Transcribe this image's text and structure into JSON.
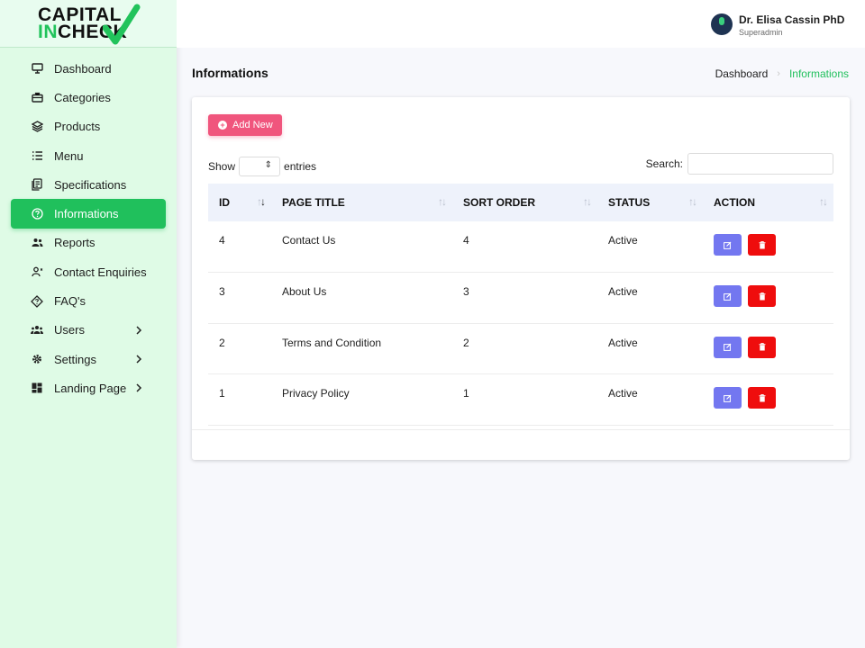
{
  "logo": {
    "line1": "CAPITAL",
    "line2_accent": "IN",
    "line2_rest": "CHECK",
    "brand_color": "#21c35b"
  },
  "user": {
    "name": "Dr. Elisa Cassin PhD",
    "role": "Superadmin"
  },
  "sidebar": {
    "items": [
      {
        "label": "Dashboard",
        "icon": "monitor-icon",
        "active": false,
        "has_submenu": false
      },
      {
        "label": "Categories",
        "icon": "briefcase-icon",
        "active": false,
        "has_submenu": false
      },
      {
        "label": "Products",
        "icon": "layers-icon",
        "active": false,
        "has_submenu": false
      },
      {
        "label": "Menu",
        "icon": "list-icon",
        "active": false,
        "has_submenu": false
      },
      {
        "label": "Specifications",
        "icon": "document-icon",
        "active": false,
        "has_submenu": false
      },
      {
        "label": "Informations",
        "icon": "question-circle-icon",
        "active": true,
        "has_submenu": false
      },
      {
        "label": "Reports",
        "icon": "user-group-icon",
        "active": false,
        "has_submenu": false
      },
      {
        "label": "Contact Enquiries",
        "icon": "contact-icon",
        "active": false,
        "has_submenu": false
      },
      {
        "label": "FAQ's",
        "icon": "diamond-help-icon",
        "active": false,
        "has_submenu": false
      },
      {
        "label": "Users",
        "icon": "users-icon",
        "active": false,
        "has_submenu": true
      },
      {
        "label": "Settings",
        "icon": "gear-icon",
        "active": false,
        "has_submenu": true
      },
      {
        "label": "Landing Page",
        "icon": "dashboard-grid-icon",
        "active": false,
        "has_submenu": true
      }
    ],
    "active_color": "#20c05c"
  },
  "page": {
    "title": "Informations"
  },
  "breadcrumb": {
    "home": "Dashboard",
    "separator": "›",
    "current": "Informations"
  },
  "toolbar": {
    "add_label": "Add New",
    "show_label": "Show",
    "entries_label": "entries",
    "search_label": "Search:",
    "search_value": ""
  },
  "table": {
    "columns": [
      "ID",
      "PAGE TITLE",
      "SORT ORDER",
      "STATUS",
      "ACTION"
    ],
    "rows": [
      {
        "id": "4",
        "title": "Contact Us",
        "sort": "4",
        "status": "Active"
      },
      {
        "id": "3",
        "title": "About Us",
        "sort": "3",
        "status": "Active"
      },
      {
        "id": "2",
        "title": "Terms and Condition",
        "sort": "2",
        "status": "Active"
      },
      {
        "id": "1",
        "title": "Privacy Policy",
        "sort": "1",
        "status": "Active"
      }
    ]
  },
  "colors": {
    "add_button": "#f0557d",
    "edit_button": "#7377f0",
    "delete_button": "#ef0d0d"
  }
}
